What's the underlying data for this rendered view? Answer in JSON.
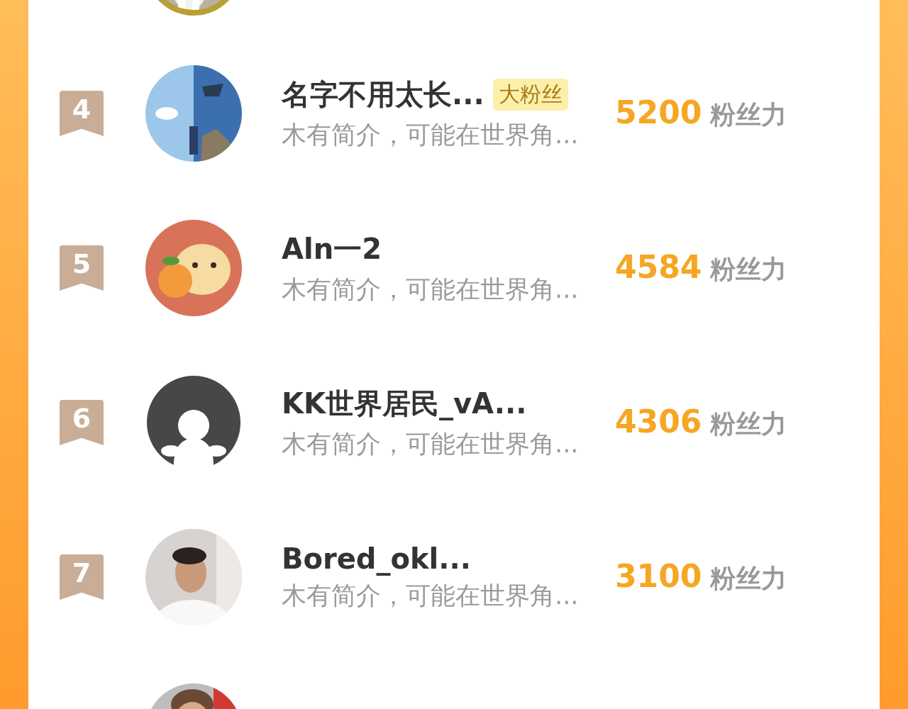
{
  "rows": [
    {
      "rank": "4",
      "name": "名字不用太长...",
      "tag": "大粉丝",
      "intro": "木有简介，可能在世界角...",
      "score": "5200",
      "unit": "粉丝力"
    },
    {
      "rank": "5",
      "name": "Aln一2",
      "intro": "木有简介，可能在世界角...",
      "score": "4584",
      "unit": "粉丝力"
    },
    {
      "rank": "6",
      "avatar": {
        "kind": "default"
      },
      "name": "KK世界居民_vA...",
      "intro": "木有简介，可能在世界角...",
      "score": "4306",
      "unit": "粉丝力"
    },
    {
      "rank": "7",
      "name": "Bored_okl...",
      "intro": "木有简介，可能在世界角...",
      "score": "3100",
      "unit": "粉丝力"
    }
  ]
}
